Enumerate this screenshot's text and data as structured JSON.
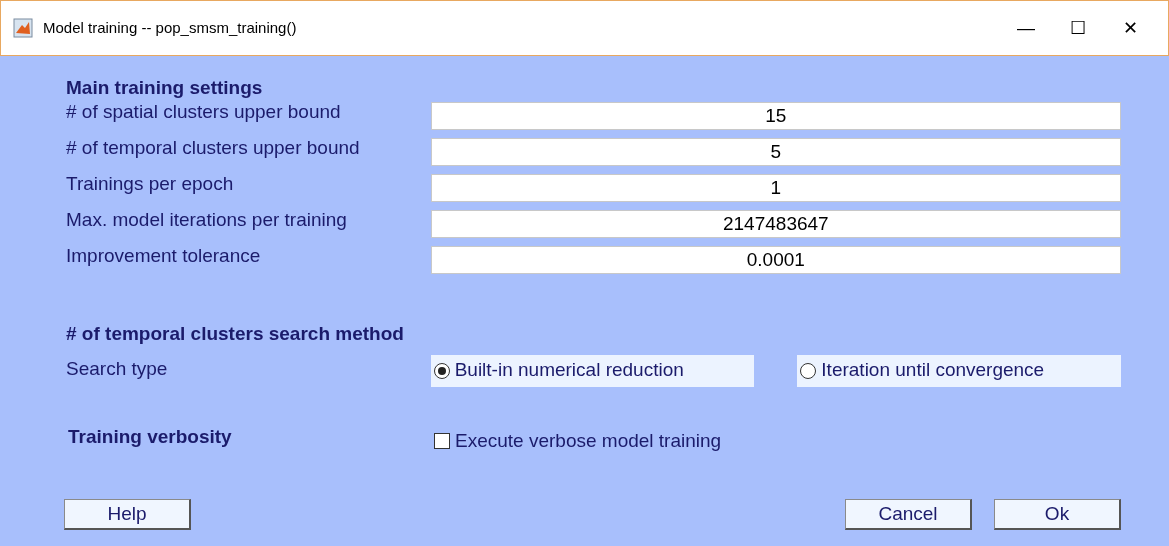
{
  "window": {
    "title": "Model training -- pop_smsm_training()",
    "controls": [
      "—",
      "☐",
      "✕"
    ]
  },
  "main_settings": {
    "heading": "Main training settings",
    "fields": [
      {
        "label": "# of spatial clusters upper bound",
        "value": "15"
      },
      {
        "label": "# of temporal clusters upper bound",
        "value": "5"
      },
      {
        "label": "Trainings per epoch",
        "value": "1"
      },
      {
        "label": "Max. model iterations per training",
        "value": "2147483647"
      },
      {
        "label": "Improvement tolerance",
        "value": "0.0001"
      }
    ]
  },
  "search_method": {
    "heading": "# of temporal clusters search method",
    "label": "Search type",
    "options": [
      {
        "label": "Built-in numerical reduction",
        "selected": true
      },
      {
        "label": "Iteration until convergence",
        "selected": false
      }
    ]
  },
  "verbosity": {
    "heading": "Training verbosity",
    "checkbox": {
      "label": "Execute verbose model training",
      "checked": false
    }
  },
  "buttons": {
    "left": [
      {
        "label": "Help"
      }
    ],
    "right": [
      {
        "label": "Cancel"
      },
      {
        "label": "Ok"
      }
    ]
  }
}
